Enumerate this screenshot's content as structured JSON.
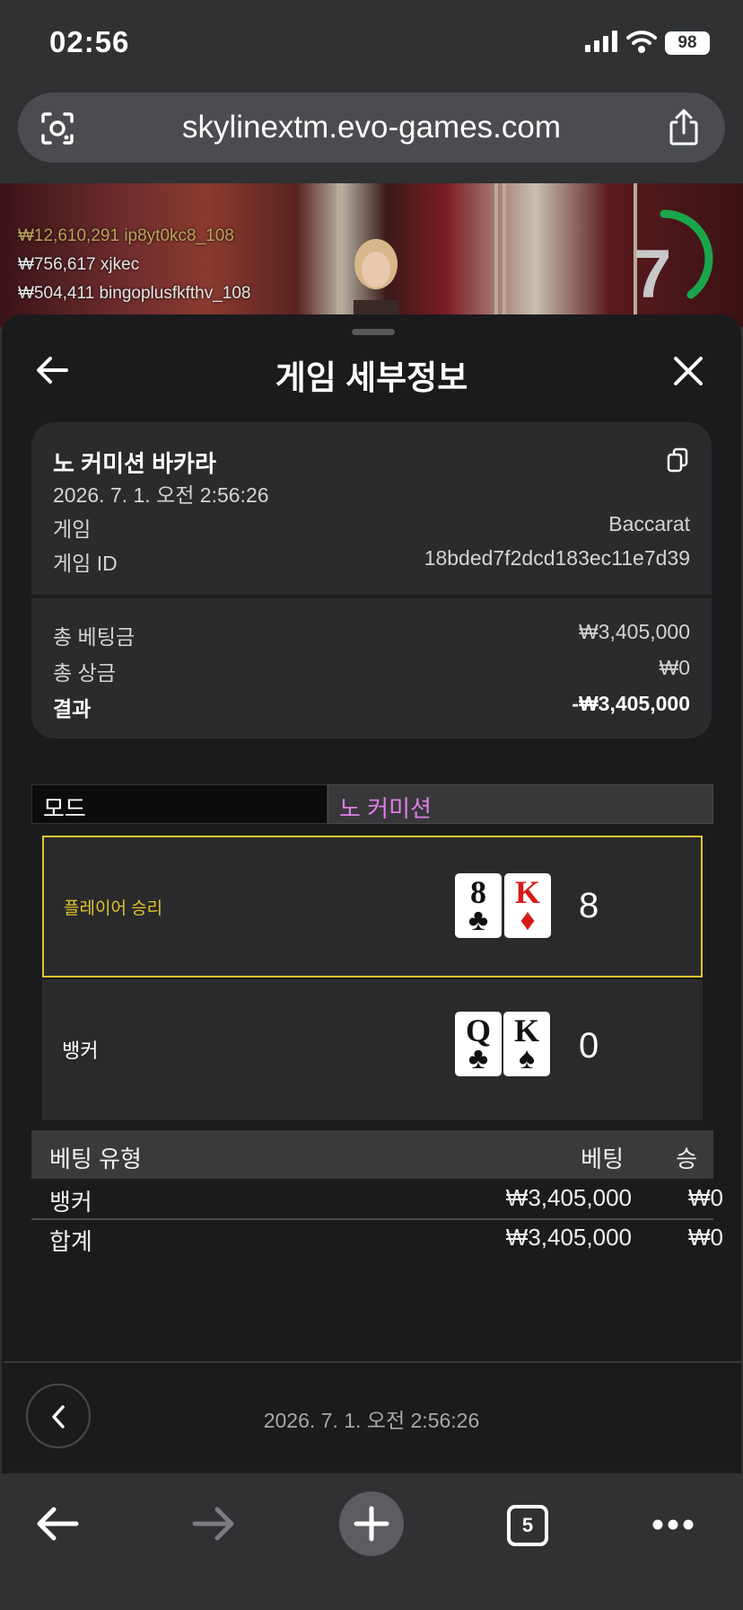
{
  "status_bar": {
    "time": "02:56",
    "battery": "98"
  },
  "browser": {
    "url": "skylinextm.evo-games.com",
    "tab_count": "5"
  },
  "live": {
    "leaderboard": [
      {
        "amount": "₩12,610,291",
        "user": "ip8yt0kc8_108"
      },
      {
        "amount": "₩756,617",
        "user": "xjkec"
      },
      {
        "amount": "₩504,411",
        "user": "bingoplusfkfthv_108"
      }
    ],
    "countdown": "7"
  },
  "sheet": {
    "title": "게임 세부정보",
    "game_name": "노 커미션 바카라",
    "datetime": "2026. 7. 1. 오전 2:56:26",
    "game_label": "게임",
    "game_value": "Baccarat",
    "game_id_label": "게임 ID",
    "game_id_value": "18bded7f2dcd183ec11e7d39",
    "total_bet_label": "총 베팅금",
    "total_bet_value": "₩3,405,000",
    "total_win_label": "총 상금",
    "total_win_value": "₩0",
    "result_label": "결과",
    "result_value": "-₩3,405,000"
  },
  "mode": {
    "label": "모드",
    "value": "노 커미션"
  },
  "outcome": {
    "player": {
      "label": "플레이어 승리",
      "score": "8",
      "cards": [
        {
          "rank": "8",
          "suit": "♣"
        },
        {
          "rank": "K",
          "suit": "♦"
        }
      ]
    },
    "banker": {
      "label": "뱅커",
      "score": "0",
      "cards": [
        {
          "rank": "Q",
          "suit": "♣"
        },
        {
          "rank": "K",
          "suit": "♠"
        }
      ]
    }
  },
  "bets": {
    "headers": {
      "type": "베팅 유형",
      "bet": "베팅",
      "win": "승"
    },
    "rows": [
      {
        "type": "뱅커",
        "bet": "₩3,405,000",
        "win": "₩0"
      }
    ],
    "total": {
      "type": "합계",
      "bet": "₩3,405,000",
      "win": "₩0"
    }
  },
  "footer": {
    "date": "2026. 7. 1. 오전 2:56:26"
  },
  "colors": {
    "accent_yellow": "#e1c52a",
    "mode_pink": "#e07ee6",
    "ring_green": "#19a64b"
  },
  "icons": [
    "lens-icon",
    "share-icon",
    "back-arrow-icon",
    "close-icon",
    "copy-icon",
    "chevron-left-icon",
    "nav-back-icon",
    "nav-forward-icon",
    "new-tab-icon",
    "tabs-icon",
    "more-icon"
  ]
}
